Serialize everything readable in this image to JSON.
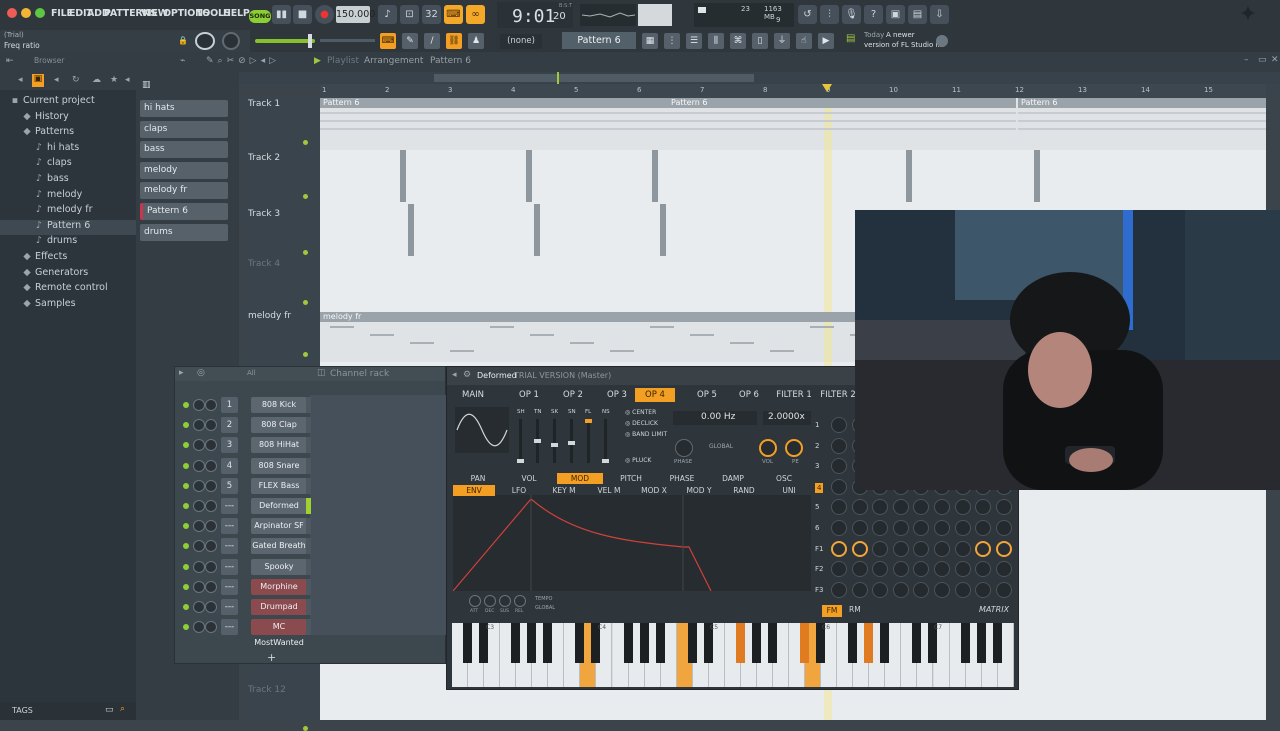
{
  "menu": [
    "FILE",
    "EDIT",
    "ADD",
    "PATTERNS",
    "VIEW",
    "OPTIONS",
    "TOOLS",
    "HELP"
  ],
  "transport": {
    "song_label": "SONG",
    "tempo": "150.000",
    "time": "9:01",
    "time_sub": "20",
    "time_top": "B:S:T"
  },
  "cpu": {
    "voices": "23",
    "memory": "1163 MB",
    "polyphony": "9"
  },
  "hint": {
    "line1": "(Trial)",
    "line2": "Freq ratio"
  },
  "toolbar2": {
    "preset_value": "(none)",
    "pattern_name": "Pattern 6",
    "news_label": "Today",
    "news_text": "A newer",
    "news_text2": "version of FL Studio i..."
  },
  "browser": {
    "header_label": "Browser",
    "items": [
      {
        "label": "Current project",
        "icon": "folder-icon",
        "sel": false
      },
      {
        "label": "History",
        "icon": "history-icon",
        "sel": false
      },
      {
        "label": "Patterns",
        "icon": "pattern-icon",
        "sel": false
      },
      {
        "label": "hi hats",
        "icon": "note-icon",
        "sel": false
      },
      {
        "label": "claps",
        "icon": "note-icon",
        "sel": false
      },
      {
        "label": "bass",
        "icon": "note-icon",
        "sel": false
      },
      {
        "label": "melody",
        "icon": "note-icon",
        "sel": false
      },
      {
        "label": "melody fr",
        "icon": "note-icon",
        "sel": false
      },
      {
        "label": "Pattern 6",
        "icon": "note-icon",
        "sel": true
      },
      {
        "label": "drums",
        "icon": "note-icon",
        "sel": false
      },
      {
        "label": "Effects",
        "icon": "plug-icon",
        "sel": false
      },
      {
        "label": "Generators",
        "icon": "plug-icon",
        "sel": false
      },
      {
        "label": "Remote control",
        "icon": "remote-icon",
        "sel": false
      },
      {
        "label": "Samples",
        "icon": "wave-icon",
        "sel": false
      }
    ],
    "tags_label": "TAGS"
  },
  "picker": [
    "hi hats",
    "claps",
    "bass",
    "melody",
    "melody fr",
    "Pattern 6",
    "drums"
  ],
  "playlist": {
    "title": "Playlist",
    "crumb1": "Arrangement",
    "crumb2": "Pattern 6",
    "ruler": [
      "1",
      "2",
      "3",
      "4",
      "5",
      "6",
      "7",
      "8",
      "9",
      "10",
      "11",
      "12",
      "13",
      "14",
      "15"
    ],
    "tracks": [
      "Track 1",
      "Track 2",
      "Track 3",
      "Track 4",
      "melody fr",
      "Track 12"
    ],
    "clip_labels": [
      "Pattern 6",
      "Pattern 6",
      "Pattern 6",
      "melody fr"
    ]
  },
  "channel_rack": {
    "title": "Channel rack",
    "filter": "All",
    "channels": [
      {
        "num": "1",
        "name": "808 Kick",
        "red": false
      },
      {
        "num": "2",
        "name": "808 Clap",
        "red": false
      },
      {
        "num": "3",
        "name": "808 HiHat",
        "red": false
      },
      {
        "num": "4",
        "name": "808 Snare",
        "red": false
      },
      {
        "num": "5",
        "name": "FLEX Bass",
        "red": false
      },
      {
        "num": "---",
        "name": "Deformed",
        "red": false
      },
      {
        "num": "---",
        "name": "Arpinator SF",
        "red": false
      },
      {
        "num": "---",
        "name": "Gated Breath",
        "red": false
      },
      {
        "num": "---",
        "name": "Spooky",
        "red": false
      },
      {
        "num": "---",
        "name": "Morphine",
        "red": true
      },
      {
        "num": "---",
        "name": "Drumpad",
        "red": true
      },
      {
        "num": "---",
        "name": "MC MostWanted",
        "red": true
      }
    ],
    "add_label": "+"
  },
  "plugin": {
    "name": "Deformed",
    "suffix": "TRIAL VERSION (Master)",
    "tabs": [
      "MAIN",
      "OP 1",
      "OP 2",
      "OP 3",
      "OP 4",
      "OP 5",
      "OP 6",
      "FILTER 1",
      "FILTER 2"
    ],
    "active_tab": "OP 4",
    "sliders": [
      "SH",
      "TN",
      "SK",
      "SN",
      "FL",
      "NS"
    ],
    "options": [
      "CENTER",
      "DECLICK",
      "BAND LIMIT",
      "PLUCK"
    ],
    "freq": "0.00 Hz",
    "ratio": "2.0000x",
    "knobs": [
      "PHASE",
      "GLOBAL",
      "VOL",
      "PE"
    ],
    "mod_tabs": [
      "PAN",
      "VOL",
      "MOD",
      "PITCH",
      "PHASE",
      "DAMP",
      "OSC"
    ],
    "active_mod": "MOD",
    "env_tabs": [
      "ENV",
      "LFO",
      "KEY M",
      "VEL M",
      "MOD X",
      "MOD Y",
      "RAND",
      "UNI"
    ],
    "active_env": "ENV",
    "env_knobs": [
      "ATT",
      "DEC",
      "SUS",
      "REL"
    ],
    "env_opts": [
      "TEMPO",
      "GLOBAL"
    ],
    "matrix_rows": [
      "1",
      "2",
      "3",
      "4",
      "5",
      "6",
      "F1",
      "F2",
      "F3"
    ],
    "fm": "FM",
    "rm": "RM",
    "matrix": "MATRIX",
    "octaves": [
      "C3",
      "C4",
      "C5",
      "C6",
      "C7"
    ]
  },
  "colors": {
    "accent": "#f29f24",
    "led": "#8ed033",
    "bg": "#3b444b"
  }
}
